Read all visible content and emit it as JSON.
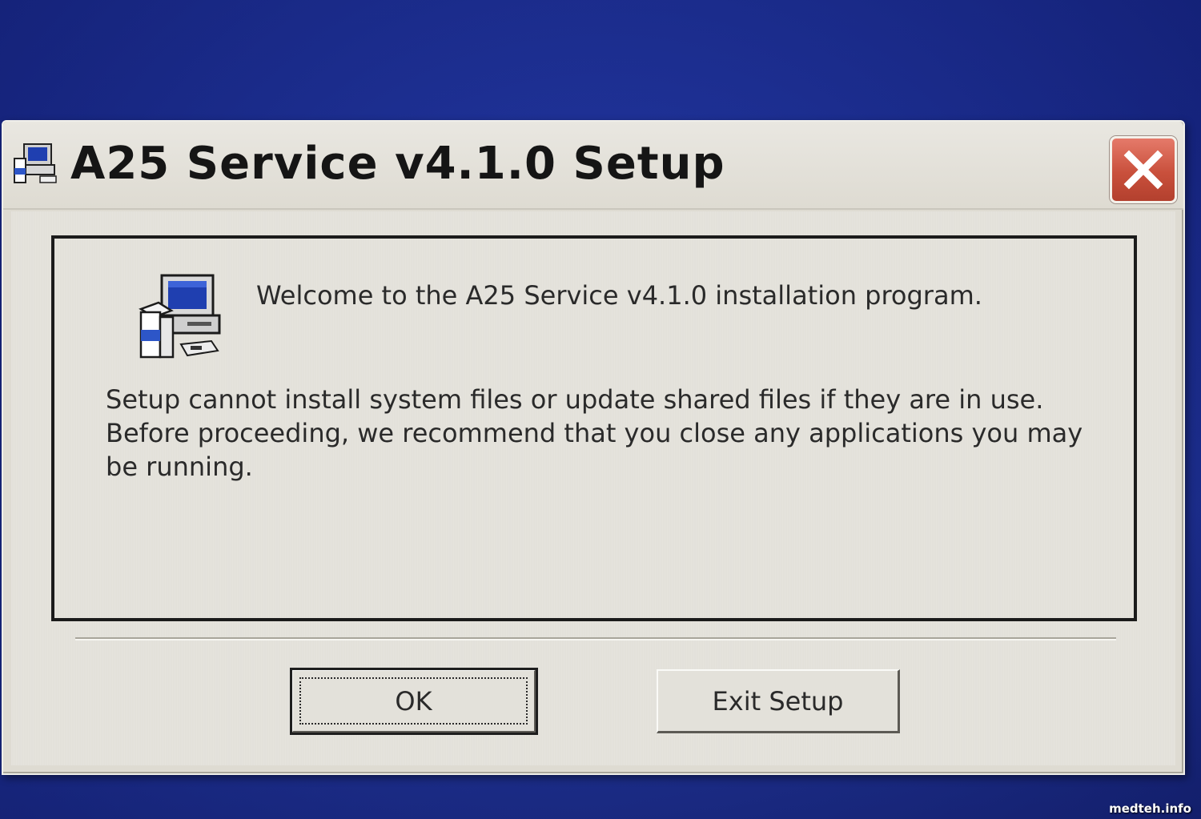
{
  "window": {
    "title": "A25 Service v4.1.0 Setup",
    "close_icon": "close-x-icon"
  },
  "dialog": {
    "welcome": "Welcome to the A25 Service v4.1.0 installation program.",
    "message": "Setup cannot install system files or update shared files if they are in use. Before proceeding, we recommend that you close any applications you may be running.",
    "icon": "setup-computer-icon"
  },
  "buttons": {
    "ok_label": "OK",
    "exit_label": "Exit Setup"
  },
  "watermark": "medteh.info",
  "colors": {
    "desktop": "#1c2f9a",
    "window_face": "#dedbd2",
    "close_button": "#c9503c"
  }
}
